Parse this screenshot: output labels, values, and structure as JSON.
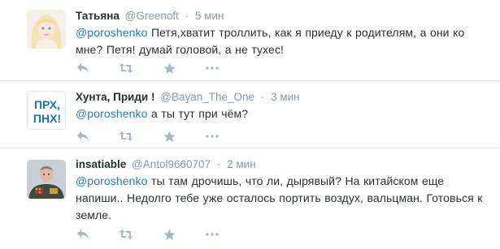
{
  "tweets": [
    {
      "fullname": "Татьяна",
      "username": "@Greenoft",
      "time": "5 мин",
      "mention": "@poroshenko",
      "text": " Петя,хватит троллить, как я приеду к родителям, а они ко мне? Петя! думай головой, а не тухес!"
    },
    {
      "fullname": "Хунта, Приди !",
      "username": "@Bayan_The_One",
      "time": "3 мин",
      "mention": "@poroshenko",
      "text": " а ты тут при чём?",
      "avatar_text_line1": "ПРХ,",
      "avatar_text_line2": "ПНХ!"
    },
    {
      "fullname": "insatiable",
      "username": "@Antol9660707",
      "time": "2 мин",
      "mention": "@poroshenko",
      "text": " ты там дрочишь, что ли, дырявый? На китайском еще напиши.. Недолго тебе уже осталось портить воздух, вальцман. Готовься к земле."
    }
  ],
  "icons": {
    "reply": "reply-icon",
    "retweet": "retweet-icon",
    "favorite": "star-icon",
    "more": "more-icon"
  },
  "colors": {
    "mention": "#2b7bb9",
    "meta": "#8899a6",
    "icon": "#aab8c2",
    "divider": "#e1e8ed"
  }
}
